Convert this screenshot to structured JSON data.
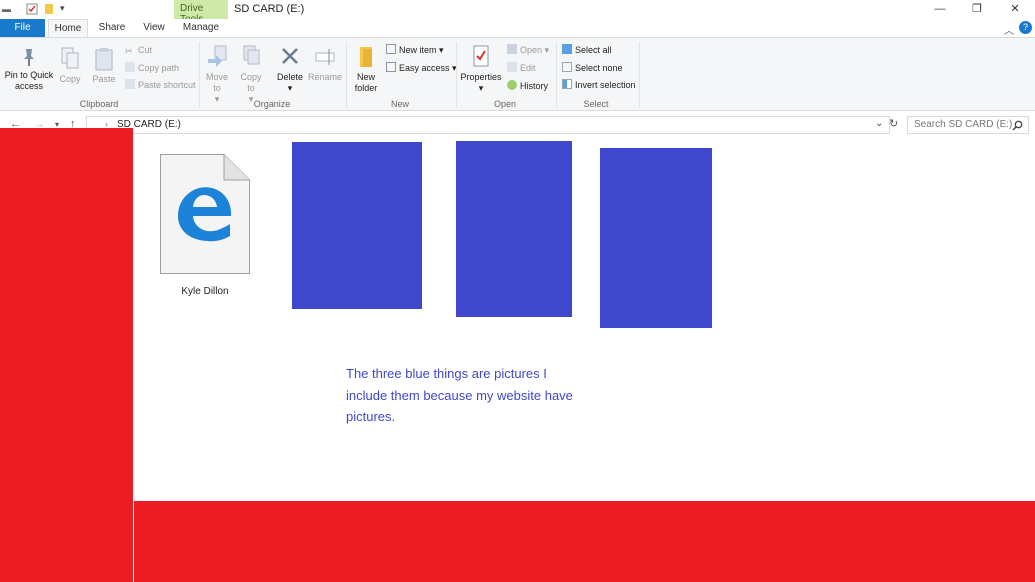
{
  "window": {
    "title": "SD CARD (E:)",
    "contextual_tab": "Drive Tools"
  },
  "tabs": [
    "File",
    "Home",
    "Share",
    "View",
    "Manage"
  ],
  "ribbon": {
    "clipboard": {
      "label": "Clipboard",
      "pin": "Pin to Quick access",
      "copy": "Copy",
      "paste": "Paste",
      "cut": "Cut",
      "copy_path": "Copy path",
      "paste_shortcut": "Paste shortcut"
    },
    "organize": {
      "label": "Organize",
      "move_to": "Move to",
      "copy_to": "Copy to",
      "delete": "Delete",
      "rename": "Rename"
    },
    "new": {
      "label": "New",
      "new_folder": "New folder",
      "new_item": "New item",
      "easy_access": "Easy access"
    },
    "open": {
      "label": "Open",
      "properties": "Properties",
      "open": "Open",
      "edit": "Edit",
      "history": "History"
    },
    "select": {
      "label": "Select",
      "select_all": "Select all",
      "select_none": "Select none",
      "invert_selection": "Invert selection"
    }
  },
  "address": {
    "path": "SD CARD (E:)",
    "search_placeholder": "Search SD CARD (E:)"
  },
  "files": [
    {
      "name": "Kyle Dillon",
      "icon": "edge-html-file-icon"
    }
  ],
  "note": "The three blue things are pictures I include them because my website have pictures.",
  "colors": {
    "red": "#ed1c24",
    "blue": "#3f48cc",
    "file_tab": "#1979ca",
    "drive_tools": "#cfe9a9"
  }
}
